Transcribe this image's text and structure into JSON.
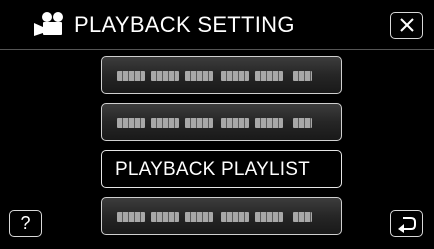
{
  "header": {
    "title": "PLAYBACK SETTING",
    "mode_icon": "video-camera-icon",
    "close_icon": "close-icon"
  },
  "menu": {
    "items": [
      {
        "label": "",
        "masked": true
      },
      {
        "label": "",
        "masked": true
      },
      {
        "label": "PLAYBACK PLAYLIST",
        "masked": false
      },
      {
        "label": "",
        "masked": true
      }
    ]
  },
  "footer": {
    "help_label": "?",
    "back_icon": "return-arrow-icon"
  },
  "colors": {
    "background": "#000000",
    "button_border": "#cfcfcf",
    "text": "#ffffff"
  }
}
